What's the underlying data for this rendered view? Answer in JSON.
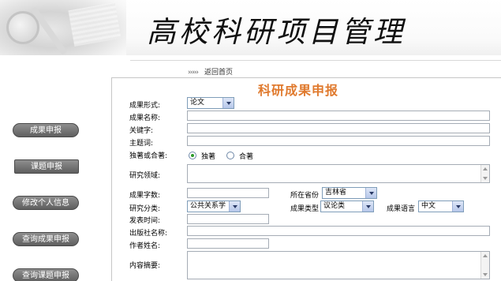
{
  "header": {
    "title": "高校科研项目管理",
    "return_arrows": "›››››",
    "return_label": "返回首页"
  },
  "sidebar": {
    "items": [
      {
        "label": "成果申报"
      },
      {
        "label": "课题申报"
      },
      {
        "label": "修改个人信息"
      },
      {
        "label": "查询成果申报"
      },
      {
        "label": "查询课题申报"
      }
    ]
  },
  "form": {
    "title": "科研成果申报",
    "result_form": {
      "label": "成果形式:",
      "value": "论文"
    },
    "result_name": {
      "label": "成果名称:",
      "value": ""
    },
    "keywords": {
      "label": "关键字:",
      "value": ""
    },
    "subject_words": {
      "label": "主题词:",
      "value": ""
    },
    "authorship": {
      "label": "独著或合著:",
      "options": [
        "独著",
        "合著"
      ],
      "selected": "独著"
    },
    "research_field": {
      "label": "研究领域:",
      "value": ""
    },
    "word_count": {
      "label": "成果字数:",
      "value": ""
    },
    "province": {
      "label": "所在省份",
      "value": "吉林省"
    },
    "category": {
      "label": "研究分类:",
      "value": "公共关系学"
    },
    "result_type": {
      "label": "成果类型",
      "value": "议论类"
    },
    "language": {
      "label": "成果语言",
      "value": "中文"
    },
    "publish_time": {
      "label": "发表时间:",
      "value": ""
    },
    "publisher": {
      "label": "出版社名称:",
      "value": ""
    },
    "author": {
      "label": "作者姓名:",
      "value": ""
    },
    "abstract": {
      "label": "内容摘要:",
      "value": ""
    }
  }
}
